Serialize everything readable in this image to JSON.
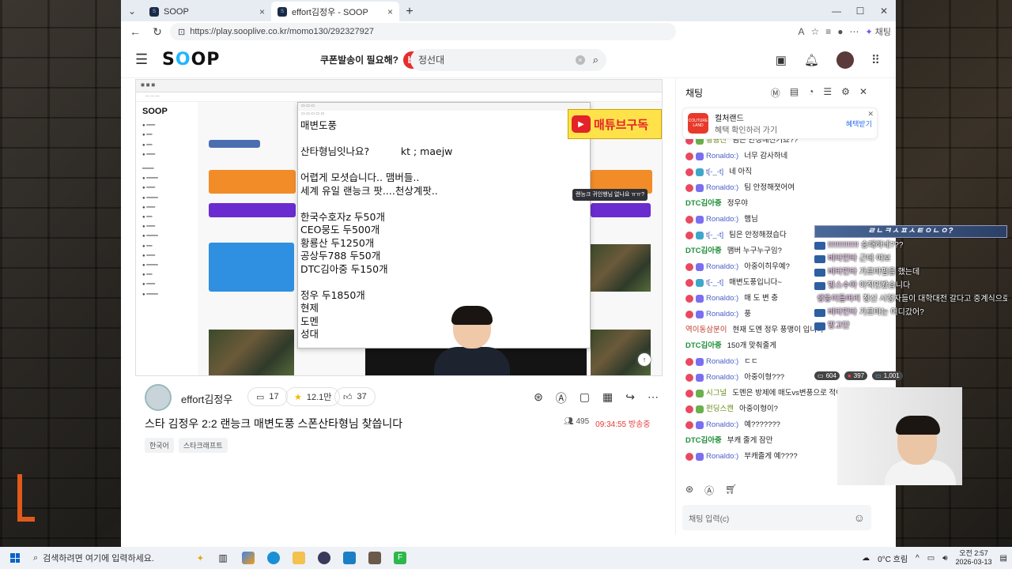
{
  "browser": {
    "tabs": [
      {
        "label": "SOOP",
        "active": false
      },
      {
        "label": "effort김정우 - SOOP",
        "active": true
      }
    ],
    "url": "https://play.sooplive.co.kr/momo130/292327927",
    "chat_label": "채팅"
  },
  "site": {
    "logo": "SOOP",
    "promo_text": "쿠폰발송이 필요해?",
    "search_value": "정선대"
  },
  "player": {
    "inner_side_title": "SOOP",
    "notepad_lines": "매변도풍\n\n산타형님잇나요?          kt ; maejw\n\n어렵게 모셧습니다.. 맴버들..\n세계 유일 랜능크 팟....천상계팟..\n\n한국수호자z 두50개\nCEO뭉도 두500개\n황룡산 두1250개\n공상두788 두50개\nDTC김아중 두150개\n\n정우 두1850개\n현제\n도멘\n성대",
    "maetube_label": "매튜브구독",
    "inner_chat_bubble": "랜능크 귀인행님 없나요 ㅠㅠ?"
  },
  "stream": {
    "channel_name": "effort김정우",
    "comments": "17",
    "stars": "12.1만",
    "likes": "37",
    "title": "스타 김정우 2:2 랜능크 매변도풍 스폰산타형님 찾씁니다",
    "viewers": "495",
    "duration": "09:34:55 방송중",
    "tags": [
      "한국어",
      "스타크래프트"
    ]
  },
  "chat": {
    "header": "채팅",
    "banner": {
      "logo": "COUTURE LAND",
      "title": "컬처랜드",
      "subtitle": "혜택 확인하러 가기",
      "link": "혜택받기"
    },
    "messages": [
      {
        "badge": "f",
        "nick": "황룡산",
        "nick_style": "olive",
        "text": "팀은 안정해진거죠??"
      },
      {
        "badge": "s",
        "nick": "Ronaldo:)",
        "nick_style": "",
        "text": "너무 감사하네"
      },
      {
        "badge": "m",
        "nick": "t[-_-t]",
        "nick_style": "",
        "text": "네 아직"
      },
      {
        "badge": "s",
        "nick": "Ronaldo:)",
        "nick_style": "",
        "text": "팀 안정해졋어여"
      },
      {
        "badge": "",
        "nick": "DTC김아중",
        "nick_style": "green",
        "text": "정우야"
      },
      {
        "badge": "s",
        "nick": "Ronaldo:)",
        "nick_style": "",
        "text": "햄님"
      },
      {
        "badge": "m",
        "nick": "t[-_-t]",
        "nick_style": "",
        "text": "팀은 안정해졌습다"
      },
      {
        "badge": "",
        "nick": "DTC김아중",
        "nick_style": "green",
        "text": "맴버 누구누구임?"
      },
      {
        "badge": "s",
        "nick": "Ronaldo:)",
        "nick_style": "",
        "text": "아중이히우예?"
      },
      {
        "badge": "m",
        "nick": "t[-_-t]",
        "nick_style": "",
        "text": "매변도풍입니다~"
      },
      {
        "badge": "s",
        "nick": "Ronaldo:)",
        "nick_style": "",
        "text": "매 도 변 충"
      },
      {
        "badge": "s",
        "nick": "Ronaldo:)",
        "nick_style": "",
        "text": "풍"
      },
      {
        "badge": "",
        "nick": "역이동삼분이",
        "nick_style": "red",
        "text": "현재 도멘 정우 풍맹이 입니다"
      },
      {
        "badge": "",
        "nick": "DTC김아중",
        "nick_style": "green",
        "text": "150개 맞춰줄게"
      },
      {
        "badge": "s",
        "nick": "Ronaldo:)",
        "nick_style": "",
        "text": "ㄷㄷ"
      },
      {
        "badge": "s",
        "nick": "Ronaldo:)",
        "nick_style": "",
        "text": "아중이형???"
      },
      {
        "badge": "f",
        "nick": "시그널",
        "nick_style": "olive",
        "text": "도멘은 방제에 매도vs변풍으로 적어놨긴데"
      },
      {
        "badge": "f",
        "nick": "펀딩스캔",
        "nick_style": "olive",
        "text": "아중이형이?"
      },
      {
        "badge": "s",
        "nick": "Ronaldo:)",
        "nick_style": "",
        "text": "예???????"
      },
      {
        "badge": "",
        "nick": "DTC김아중",
        "nick_style": "green",
        "text": "부캐 줄게 잠만"
      },
      {
        "badge": "s",
        "nick": "Ronaldo:)",
        "nick_style": "",
        "text": "부캐줄게 예????"
      }
    ],
    "input_placeholder": "채팅 입력(c)"
  },
  "overlay": {
    "title": "ㄹㄴㅋㅅㅍㅅㅌㅇㄴㅇ?",
    "lines": [
      {
        "nick": "!!!!!!!!!!!!!!",
        "text": "승패하네???"
      },
      {
        "nick": "비타민타",
        "text": "근데 여보"
      },
      {
        "nick": "비타민타",
        "text": "가르마펌을 했는데"
      },
      {
        "nick": "빙스수아",
        "text": "아직인봤습니다"
      },
      {
        "nick": "생등이들머리",
        "text": "정신 시청자들이 대학대전 갈다고 중계식으로 비꼬긴으로 암"
      },
      {
        "nick": "비타민타",
        "text": "가르마는 어디갔어?"
      },
      {
        "nick": "망고단",
        "text": ""
      }
    ],
    "stats": [
      "604",
      "397",
      "1,001"
    ]
  },
  "taskbar": {
    "search_placeholder": "검색하려면 여기에 입력하세요.",
    "weather": "0°C 흐림",
    "time": "오전 2:57",
    "date": "2026-03-13"
  }
}
